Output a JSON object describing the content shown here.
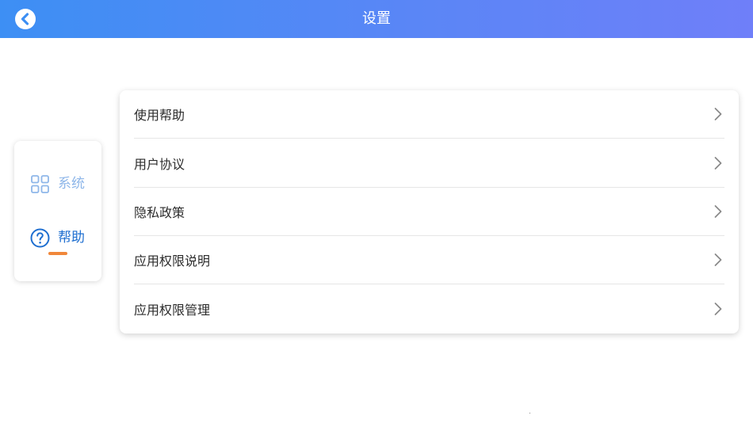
{
  "header": {
    "title": "设置",
    "back_icon": "back-arrow-icon",
    "gradient": [
      "#3d8ff4",
      "#6f7ff9"
    ]
  },
  "sidebar": {
    "items": [
      {
        "label": "系统",
        "icon": "grid-icon",
        "active": false
      },
      {
        "label": "帮助",
        "icon": "question-circle-icon",
        "active": true
      }
    ],
    "active_indicator_color": "#f0873a"
  },
  "menu": {
    "items": [
      {
        "label": "使用帮助"
      },
      {
        "label": "用户协议"
      },
      {
        "label": "隐私政策"
      },
      {
        "label": "应用权限说明"
      },
      {
        "label": "应用权限管理"
      }
    ],
    "chevron_icon": "chevron-right-icon"
  }
}
